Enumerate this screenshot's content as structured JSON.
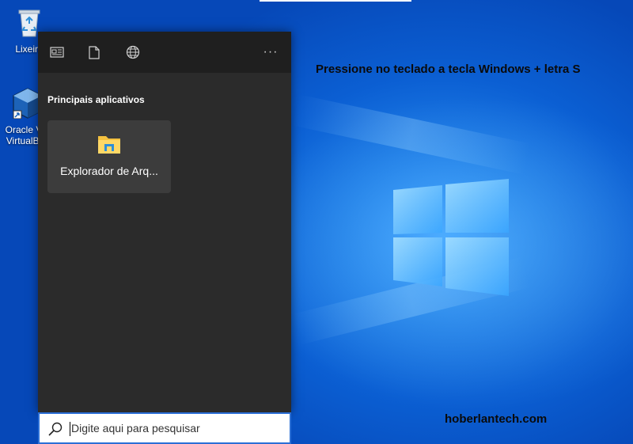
{
  "desktop": {
    "icons": [
      {
        "label": "Lixeira",
        "icon": "recycle-bin-icon"
      },
      {
        "label": "Oracle VM VirtualBox",
        "icon": "virtualbox-icon"
      }
    ],
    "instruction_text": "Pressione no teclado a tecla Windows + letra S",
    "watermark": "hoberlantech.com"
  },
  "search_panel": {
    "top_buttons": [
      {
        "icon": "news-card-icon"
      },
      {
        "icon": "document-icon"
      },
      {
        "icon": "globe-icon"
      }
    ],
    "more_label": "···",
    "section_title": "Principais aplicativos",
    "apps": [
      {
        "label": "Explorador de Arq...",
        "icon": "file-explorer-icon"
      }
    ]
  },
  "search_box": {
    "placeholder": "Digite aqui para pesquisar",
    "value": ""
  },
  "colors": {
    "panel_bg": "#2b2b2b",
    "panel_top_bg": "#1f1f1f",
    "tile_bg": "#3c3c3c",
    "accent": "#2b6fd6",
    "folder_yellow": "#f4c13f"
  }
}
